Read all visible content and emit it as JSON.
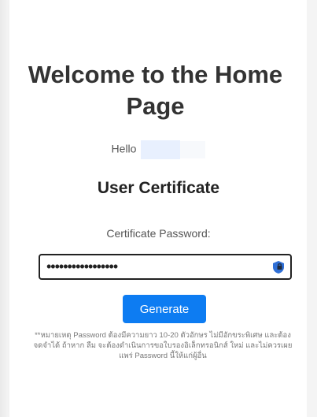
{
  "page": {
    "title": "Welcome to the Home Page",
    "hello_label": "Hello",
    "subtitle": "User Certificate",
    "password_label": "Certificate Password:",
    "password_value": "•••••••••••••••••",
    "generate_label": "Generate",
    "note": "**หมายเหตุ Password ต้องมีความยาว 10-20 ตัวอักษร ไม่มีอักขระพิเศษ และต้องจดจำได้ ถ้าหาก ลืม จะต้องดำเนินการขอใบรองอิเล็กทรอนิกส์ ใหม่ และไม่ควรเผยแพร่ Password นี้ให้แก่ผู้อื่น"
  },
  "colors": {
    "button": "#0d7cf2",
    "title": "#333333",
    "hello_highlight": "#e8f0fe"
  },
  "icons": {
    "password_manager": "password-manager-icon"
  }
}
